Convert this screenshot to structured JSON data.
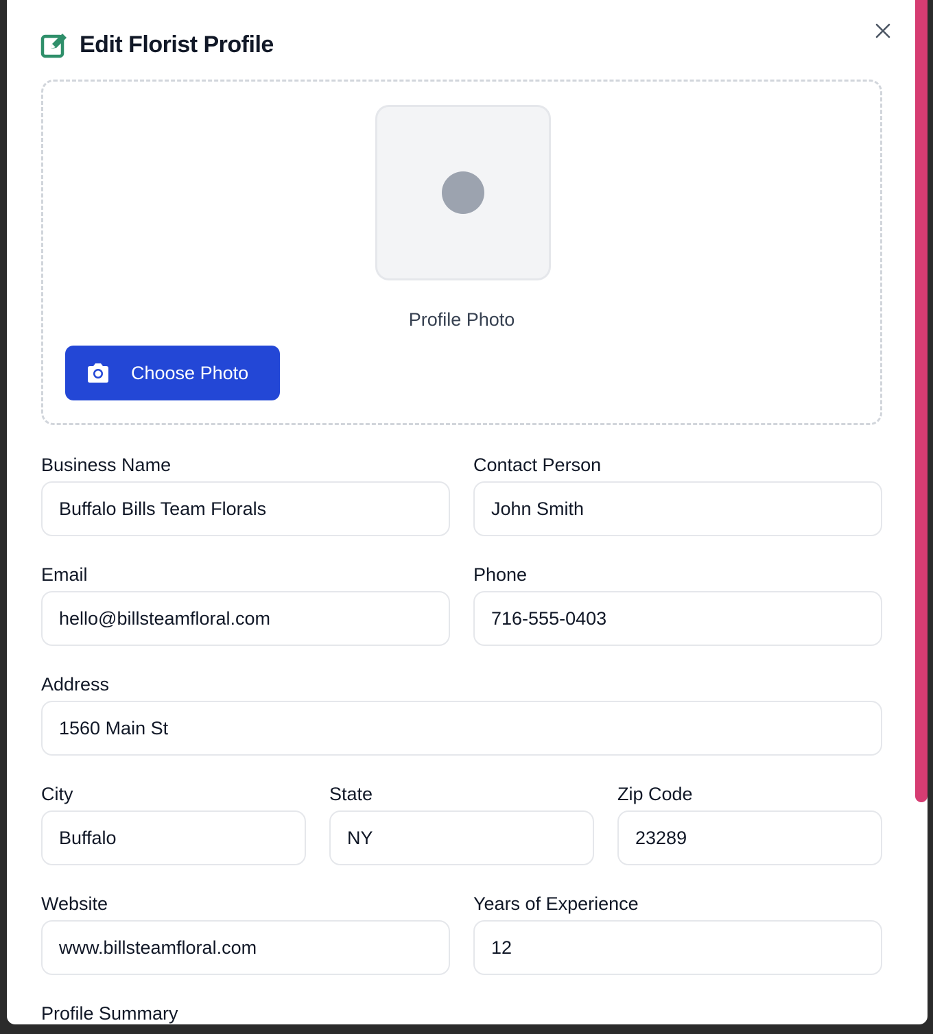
{
  "modal": {
    "title": "Edit Florist Profile",
    "accent_color": "#2f8f6a",
    "scrollbar_color": "#d63c72"
  },
  "photo": {
    "label": "Profile Photo",
    "button_label": "Choose Photo",
    "button_color": "#2347d6",
    "button_icon": "camera-icon"
  },
  "fields": {
    "business_name": {
      "label": "Business Name",
      "value": "Buffalo Bills Team Florals"
    },
    "contact_person": {
      "label": "Contact Person",
      "value": "John Smith"
    },
    "email": {
      "label": "Email",
      "value": "hello@billsteamfloral.com"
    },
    "phone": {
      "label": "Phone",
      "value": "716-555-0403"
    },
    "address": {
      "label": "Address",
      "value": "1560 Main St"
    },
    "city": {
      "label": "City",
      "value": "Buffalo"
    },
    "state": {
      "label": "State",
      "value": "NY"
    },
    "zip": {
      "label": "Zip Code",
      "value": "23289"
    },
    "website": {
      "label": "Website",
      "value": "www.billsteamfloral.com"
    },
    "experience": {
      "label": "Years of Experience",
      "value": "12"
    },
    "summary": {
      "label": "Profile Summary"
    }
  }
}
